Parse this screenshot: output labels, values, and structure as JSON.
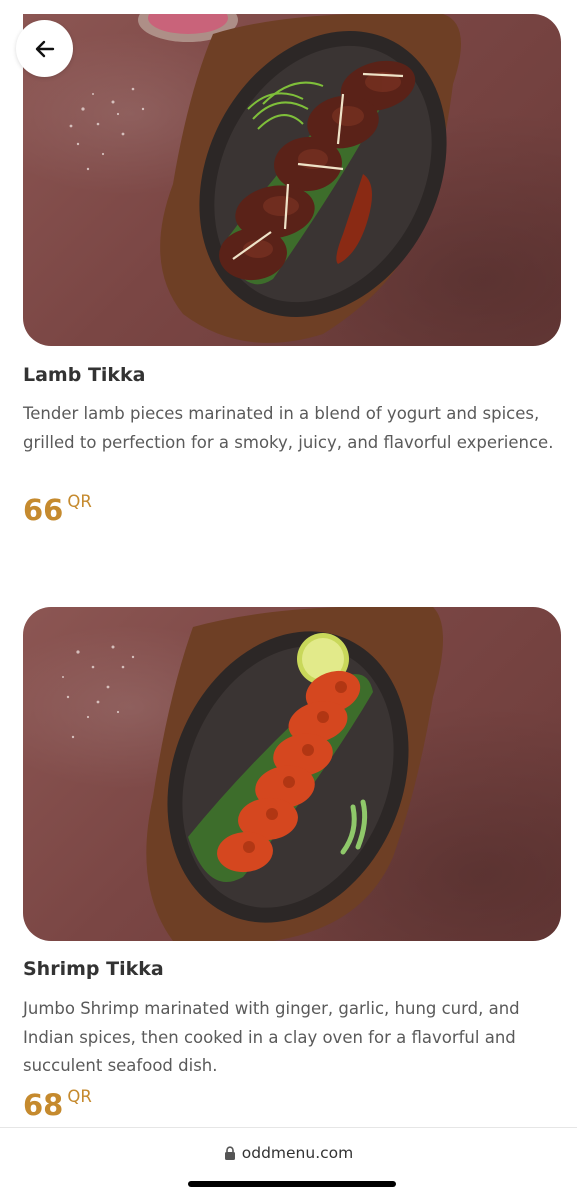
{
  "navigation": {
    "back_icon": "arrow-left-icon"
  },
  "items": [
    {
      "image_subject": "lamb-tikka-photo",
      "title": "Lamb Tikka",
      "description": "Tender lamb pieces marinated in a blend of yogurt and spices, grilled to perfection for a smoky, juicy, and flavorful experience.",
      "price": "66",
      "currency": "QR"
    },
    {
      "image_subject": "shrimp-tikka-photo",
      "title": "Shrimp Tikka",
      "description": "Jumbo Shrimp marinated with ginger, garlic, hung curd, and Indian spices, then cooked in a clay oven for a flavorful and succulent seafood dish.",
      "price": "68",
      "currency": "QR"
    }
  ],
  "browser": {
    "url": "oddmenu.com",
    "lock_icon": "lock-icon"
  },
  "colors": {
    "price": "#c58a2e",
    "text": "#333333",
    "background": "#ffffff"
  }
}
